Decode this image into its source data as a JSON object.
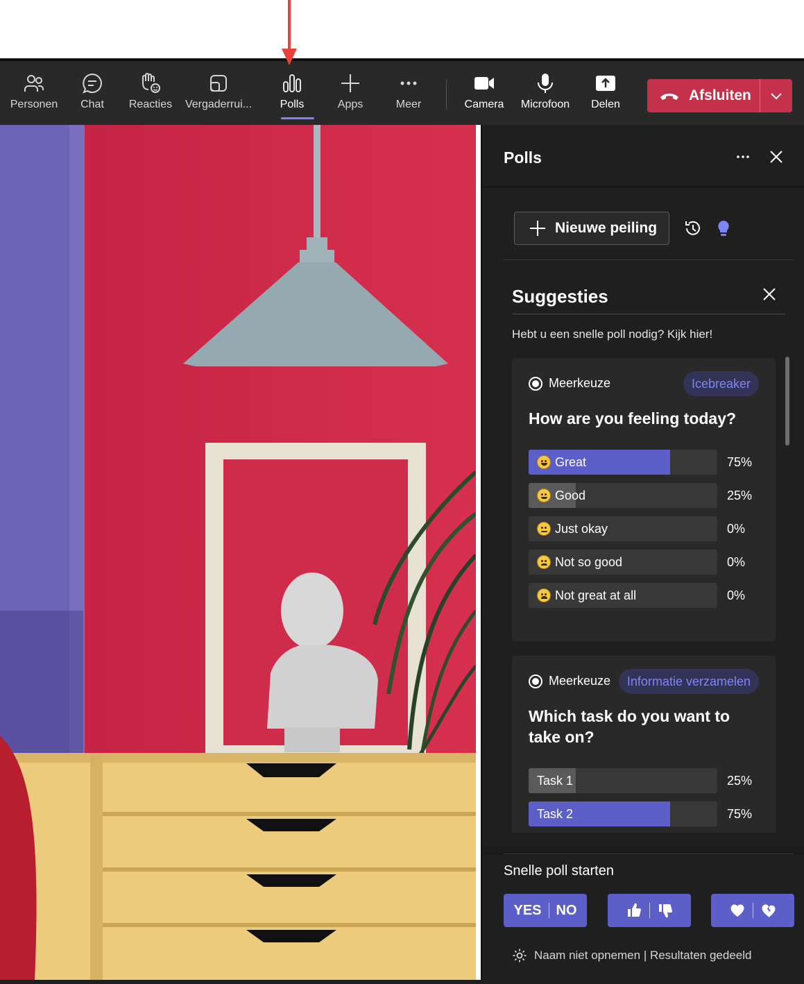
{
  "toolbar": {
    "items": [
      {
        "label": "Personen",
        "icon": "people-icon"
      },
      {
        "label": "Chat",
        "icon": "chat-icon"
      },
      {
        "label": "Reacties",
        "icon": "raise-hand-icon"
      },
      {
        "label": "Vergaderrui...",
        "icon": "rooms-icon"
      },
      {
        "label": "Polls",
        "icon": "polls-icon",
        "active": true
      },
      {
        "label": "Apps",
        "icon": "plus-icon"
      },
      {
        "label": "Meer",
        "icon": "more-icon"
      },
      {
        "label": "Camera",
        "icon": "camera-icon"
      },
      {
        "label": "Microfoon",
        "icon": "microphone-icon"
      },
      {
        "label": "Delen",
        "icon": "share-icon"
      }
    ],
    "end_call": "Afsluiten"
  },
  "panel": {
    "title": "Polls",
    "new_poll": "Nieuwe peiling",
    "suggestions": {
      "title": "Suggesties",
      "description": "Hebt u een snelle poll nodig? Kijk hier!"
    },
    "cards": [
      {
        "type": "Meerkeuze",
        "badge": "Icebreaker",
        "question": "How are you feeling today?",
        "options": [
          {
            "label": "Great",
            "percent": "75%",
            "value": 0.75,
            "fill": "purple"
          },
          {
            "label": "Good",
            "percent": "25%",
            "value": 0.25,
            "fill": "gray"
          },
          {
            "label": "Just okay",
            "percent": "0%",
            "value": 0
          },
          {
            "label": "Not so good",
            "percent": "0%",
            "value": 0
          },
          {
            "label": "Not great at all",
            "percent": "0%",
            "value": 0
          }
        ]
      },
      {
        "type": "Meerkeuze",
        "badge": "Informatie verzamelen",
        "question": "Which task do you want to take on?",
        "options": [
          {
            "label": "Task 1",
            "percent": "25%",
            "value": 0.25,
            "fill": "gray"
          },
          {
            "label": "Task 2",
            "percent": "75%",
            "value": 0.75,
            "fill": "purple"
          }
        ]
      }
    ],
    "quick_poll": {
      "title": "Snelle poll starten",
      "yes": "YES",
      "no": "NO"
    },
    "footer": "Naam niet opnemen | Resultaten gedeeld"
  },
  "colors": {
    "accent": "#5b5fc7",
    "end_call": "#c4314b",
    "panel_bg": "#1f1f1f",
    "toolbar_bg": "#292929",
    "arrow": "#e8423f"
  }
}
